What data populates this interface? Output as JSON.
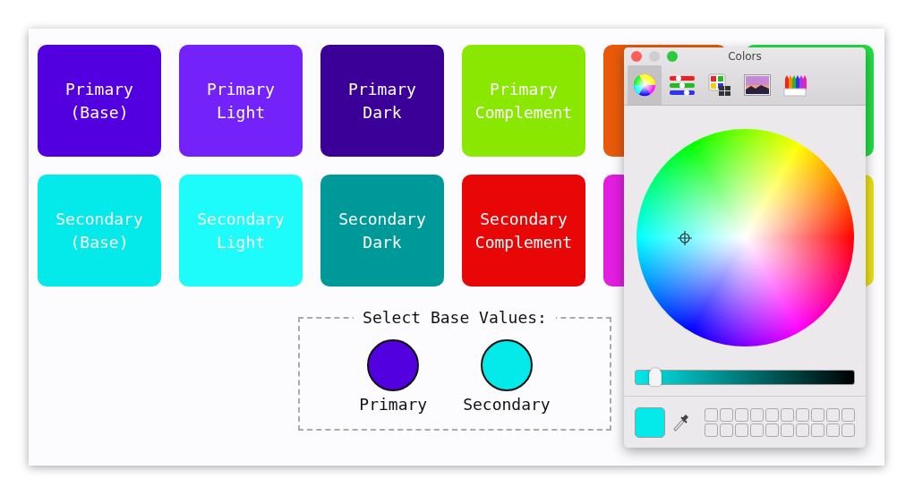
{
  "swatches": [
    {
      "label": "Primary\n(Base)",
      "color": "#5200e0"
    },
    {
      "label": "Primary\nLight",
      "color": "#7322fa"
    },
    {
      "label": "Primary\nDark",
      "color": "#3a0098"
    },
    {
      "label": "Primary\nComplement",
      "color": "#8ae800"
    },
    {
      "color": "#e85a0a"
    },
    {
      "color": "#22dd44"
    },
    {
      "label": "Secondary\n(Base)",
      "color": "#04e9ea"
    },
    {
      "label": "Secondary\nLight",
      "color": "#1dfcfb"
    },
    {
      "label": "Secondary\nDark",
      "color": "#00999a"
    },
    {
      "label": "Secondary\nComplement",
      "color": "#e80606"
    },
    {
      "color": "#e21ee0"
    },
    {
      "color": "#e8e015"
    }
  ],
  "base_values": {
    "legend": "Select Base Values:",
    "pickers": [
      {
        "label": "Primary",
        "color": "#5200e0"
      },
      {
        "label": "Secondary",
        "color": "#04e9ea"
      }
    ]
  },
  "colors_panel": {
    "title": "Colors",
    "tabs": [
      {
        "kind": "wheel",
        "selected": true
      },
      {
        "kind": "sliders",
        "selected": false
      },
      {
        "kind": "palettes",
        "selected": false
      },
      {
        "kind": "image",
        "selected": false
      },
      {
        "kind": "pencils",
        "selected": false
      }
    ],
    "brightness": {
      "level": 0.09
    },
    "color_well": {
      "color": "#04e9ea"
    }
  }
}
